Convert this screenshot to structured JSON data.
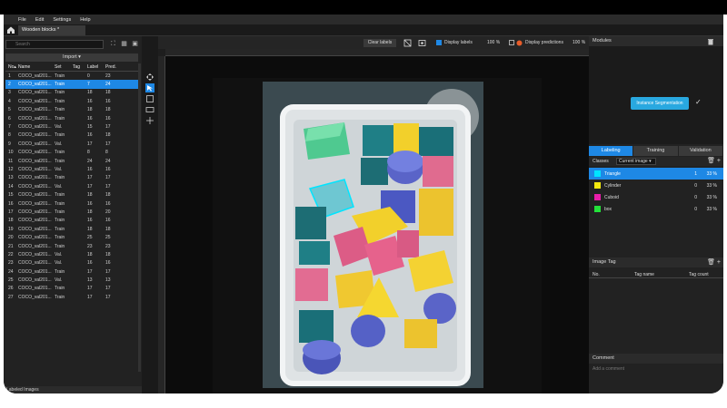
{
  "menu": [
    "File",
    "Edit",
    "Settings",
    "Help"
  ],
  "doc_tab": "Wooden blocks *",
  "left": {
    "search_placeholder": "Search",
    "import_label": "Import ▾",
    "columns": [
      "No▴",
      "Name",
      "Set",
      "Tag",
      "Label",
      "Pred."
    ],
    "rows": [
      [
        "1",
        "COCO_val201...",
        "Train",
        "",
        "0",
        "23"
      ],
      [
        "2",
        "COCO_val201...",
        "Train",
        "",
        "7",
        "24"
      ],
      [
        "3",
        "COCO_val201...",
        "Train",
        "",
        "18",
        "18"
      ],
      [
        "4",
        "COCO_val201...",
        "Train",
        "",
        "16",
        "16"
      ],
      [
        "5",
        "COCO_val201...",
        "Train",
        "",
        "18",
        "18"
      ],
      [
        "6",
        "COCO_val201...",
        "Train",
        "",
        "16",
        "16"
      ],
      [
        "7",
        "COCO_val201...",
        "Val.",
        "",
        "15",
        "17"
      ],
      [
        "8",
        "COCO_val201...",
        "Train",
        "",
        "16",
        "18"
      ],
      [
        "9",
        "COCO_val201...",
        "Val.",
        "",
        "17",
        "17"
      ],
      [
        "10",
        "COCO_val201...",
        "Train",
        "",
        "8",
        "8"
      ],
      [
        "11",
        "COCO_val201...",
        "Train",
        "",
        "24",
        "24"
      ],
      [
        "12",
        "COCO_val201...",
        "Val.",
        "",
        "16",
        "16"
      ],
      [
        "13",
        "COCO_val201...",
        "Train",
        "",
        "17",
        "17"
      ],
      [
        "14",
        "COCO_val201...",
        "Val.",
        "",
        "17",
        "17"
      ],
      [
        "15",
        "COCO_val201...",
        "Train",
        "",
        "18",
        "18"
      ],
      [
        "16",
        "COCO_val201...",
        "Train",
        "",
        "16",
        "16"
      ],
      [
        "17",
        "COCO_val201...",
        "Train",
        "",
        "18",
        "20"
      ],
      [
        "18",
        "COCO_val201...",
        "Train",
        "",
        "16",
        "16"
      ],
      [
        "19",
        "COCO_val201...",
        "Train",
        "",
        "18",
        "18"
      ],
      [
        "20",
        "COCO_val201...",
        "Train",
        "",
        "25",
        "25"
      ],
      [
        "21",
        "COCO_val201...",
        "Train",
        "",
        "23",
        "23"
      ],
      [
        "22",
        "COCO_val201...",
        "Val.",
        "",
        "18",
        "18"
      ],
      [
        "23",
        "COCO_val201...",
        "Val.",
        "",
        "16",
        "16"
      ],
      [
        "24",
        "COCO_val201...",
        "Train",
        "",
        "17",
        "17"
      ],
      [
        "25",
        "COCO_val201...",
        "Val.",
        "",
        "13",
        "13"
      ],
      [
        "26",
        "COCO_val201...",
        "Train",
        "",
        "17",
        "17"
      ],
      [
        "27",
        "COCO_val201...",
        "Train",
        "",
        "17",
        "17"
      ]
    ],
    "selected_row": 1,
    "footer": "Labeled Images"
  },
  "canvas": {
    "clear_labels": "Clear labels",
    "display_labels": "Display labels",
    "labels_pct": "100 %",
    "display_predictions": "Display predictions",
    "pred_pct": "100 %"
  },
  "right": {
    "modules_title": "Modules",
    "module_name": "Instance Segmentation",
    "tabs": [
      "Labeling",
      "Training",
      "Validation"
    ],
    "classes_label": "Classes",
    "current_image": "Current image ▾",
    "classes": [
      {
        "name": "Triangle",
        "count": "1",
        "pct": "33 %",
        "color": "#00e5ff"
      },
      {
        "name": "Cylinder",
        "count": "0",
        "pct": "33 %",
        "color": "#f4e90f"
      },
      {
        "name": "Cuboid",
        "count": "0",
        "pct": "33 %",
        "color": "#e91eaa"
      },
      {
        "name": "box",
        "count": "0",
        "pct": "33 %",
        "color": "#23e23a"
      }
    ],
    "image_tag_title": "Image Tag",
    "image_tag_cols": [
      "No.",
      "Tag name",
      "Tag count"
    ],
    "comment_title": "Comment",
    "comment_placeholder": "Add a comment"
  }
}
